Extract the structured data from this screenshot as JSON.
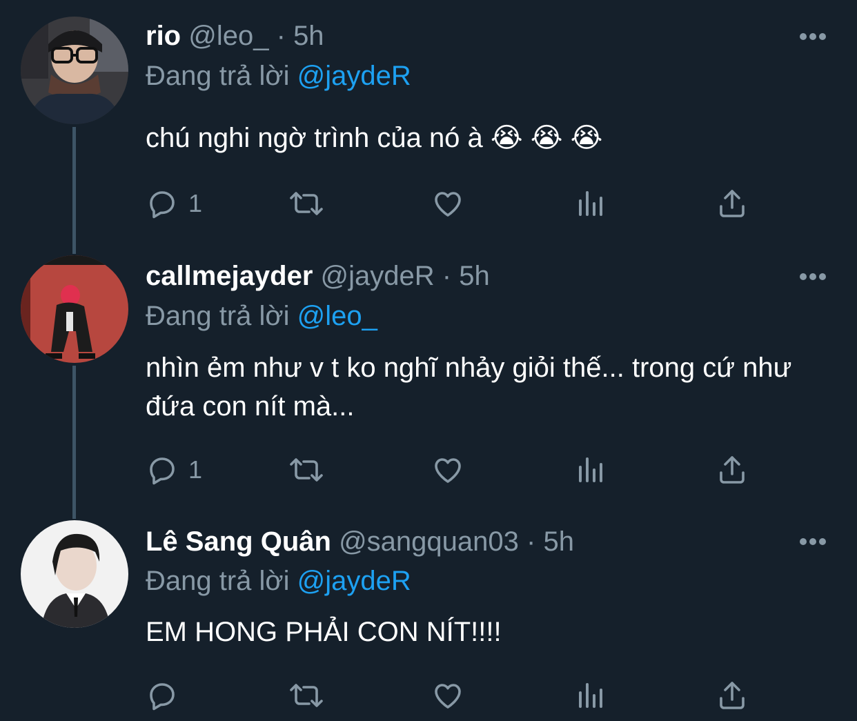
{
  "colors": {
    "background": "#15202b",
    "primary_text": "#ffffff",
    "secondary_text": "#8899a6",
    "accent": "#1da1f2",
    "thread_line": "#3d5466"
  },
  "tweets": [
    {
      "name": "rio",
      "handle": "@leo_",
      "separator": "·",
      "time": "5h",
      "replying_label": "Đang trả lời",
      "replying_to": "@jaydeR",
      "text": "chú nghi ngờ trình của nó à 😭 😭 😭",
      "reply_count": "1",
      "avatar_icon": "user-avatar-glasses"
    },
    {
      "name": "callmejayder",
      "handle": "@jaydeR",
      "separator": "·",
      "time": "5h",
      "replying_label": "Đang trả lời",
      "replying_to": "@leo_",
      "text": "nhìn ẻm như v t ko nghĩ nhảy giỏi thế... trong cứ như đứa con nít mà...",
      "reply_count": "1",
      "avatar_icon": "user-avatar-red-hair"
    },
    {
      "name": "Lê Sang Quân",
      "handle": "@sangquan03",
      "separator": "·",
      "time": "5h",
      "replying_label": "Đang trả lời",
      "replying_to": "@jaydeR",
      "text": "EM HONG PHẢI CON NÍT!!!!",
      "reply_count": "",
      "avatar_icon": "user-avatar-suit"
    }
  ],
  "action_icons": [
    "reply-icon",
    "retweet-icon",
    "like-icon",
    "analytics-icon",
    "share-icon"
  ]
}
